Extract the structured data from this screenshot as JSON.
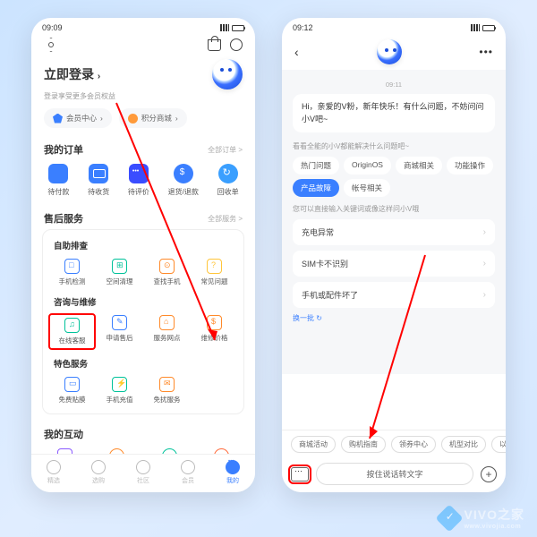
{
  "phone1": {
    "status_time": "09:09",
    "login_title": "立即登录",
    "login_sub": "登录享受更多会员权益",
    "pills": {
      "member": "会员中心",
      "points": "积分商城"
    },
    "orders": {
      "title": "我的订单",
      "more": "全部订单 >",
      "items": [
        "待付款",
        "待收货",
        "待评价",
        "退货/退款",
        "回收单"
      ]
    },
    "aftersale": {
      "title": "售后服务",
      "more": "全部服务 >",
      "self_check": "自助排查",
      "self_items": [
        "手机检测",
        "空间清理",
        "查找手机",
        "常见问题"
      ],
      "consult": "咨询与维修",
      "consult_items": [
        "在线客服",
        "申请售后",
        "服务网点",
        "维修价格"
      ],
      "special": "特色服务",
      "special_items": [
        "免费贴膜",
        "手机充值",
        "免扰服务"
      ]
    },
    "interact": {
      "title": "我的互动"
    },
    "tabs": [
      "精选",
      "选购",
      "社区",
      "会员",
      "我的"
    ]
  },
  "phone2": {
    "status_time": "09:12",
    "ts": "09:11",
    "greeting": "Hi，亲爱的V粉，新年快乐！有什么问题，不妨问问小V吧~",
    "chips_hint": "看看全能的小V都能解决什么问题吧~",
    "chips": [
      "热门问题",
      "OriginOS",
      "商城相关",
      "功能操作",
      "产品故障",
      "帐号相关"
    ],
    "chip_active_index": 4,
    "qa_hint": "您可以直接输入关键词或像这样问小V哦",
    "qa": [
      "充电异常",
      "SIM卡不识别",
      "手机或配件坏了"
    ],
    "refresh": "换一批 ↻",
    "suggestions": [
      "商城活动",
      "购机指南",
      "领券中心",
      "机型对比",
      "以"
    ],
    "voice_placeholder": "按住说话转文字"
  },
  "watermark": {
    "brand": "VIVO之家",
    "url": "www.vivojia.com"
  }
}
